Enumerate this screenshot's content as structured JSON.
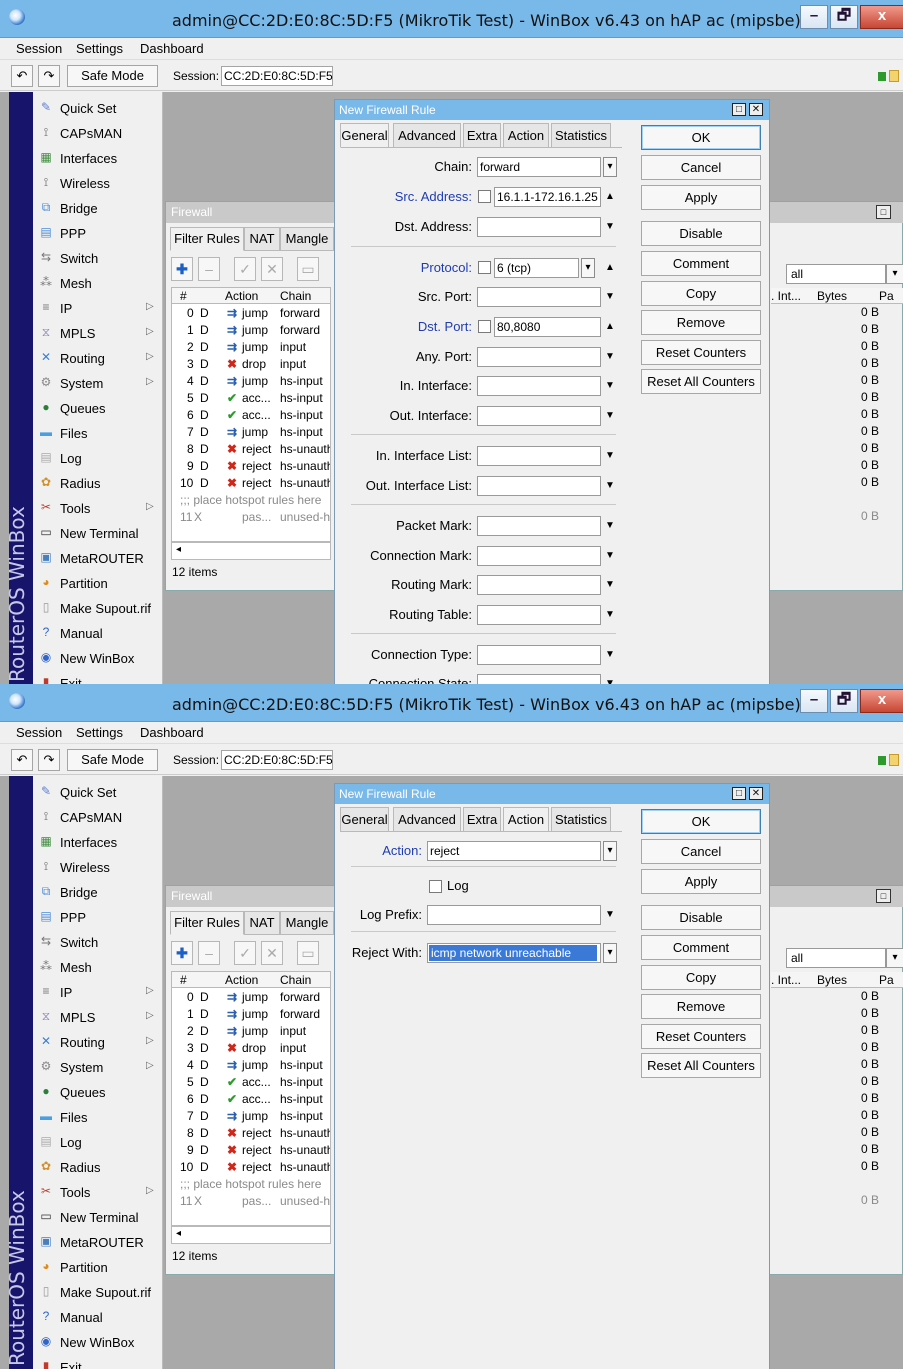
{
  "window": {
    "title": "admin@CC:2D:E0:8C:5D:F5 (MikroTik Test) - WinBox v6.43 on hAP ac (mipsbe)",
    "minimize": "–",
    "maximize": "🗗",
    "close": "x"
  },
  "menu": [
    "Session",
    "Settings",
    "Dashboard"
  ],
  "toolbar": {
    "undo": "↶",
    "redo": "↷",
    "safe_mode": "Safe Mode",
    "session_label": "Session:",
    "session_value": "CC:2D:E0:8C:5D:F5"
  },
  "brand": "RouterOS WinBox",
  "sidebar": [
    {
      "label": "Quick Set",
      "icon": "quick-set-icon",
      "color": "#5b7fd1"
    },
    {
      "label": "CAPsMAN",
      "icon": "capsman-icon",
      "color": "#6a6a6a"
    },
    {
      "label": "Interfaces",
      "icon": "interfaces-icon",
      "color": "#3d8b3d"
    },
    {
      "label": "Wireless",
      "icon": "wireless-icon",
      "color": "#6a6a6a"
    },
    {
      "label": "Bridge",
      "icon": "bridge-icon",
      "color": "#4c8bd6"
    },
    {
      "label": "PPP",
      "icon": "ppp-icon",
      "color": "#4c8bd6"
    },
    {
      "label": "Switch",
      "icon": "switch-icon",
      "color": "#777"
    },
    {
      "label": "Mesh",
      "icon": "mesh-icon",
      "color": "#777"
    },
    {
      "label": "IP",
      "icon": "ip-icon",
      "color": "#777",
      "arrow": "▷"
    },
    {
      "label": "MPLS",
      "icon": "mpls-icon",
      "color": "#8a8ab8",
      "arrow": "▷"
    },
    {
      "label": "Routing",
      "icon": "routing-icon",
      "color": "#3a7fd5",
      "arrow": "▷"
    },
    {
      "label": "System",
      "icon": "system-icon",
      "color": "#888",
      "arrow": "▷"
    },
    {
      "label": "Queues",
      "icon": "queues-icon",
      "color": "#2c7f3a"
    },
    {
      "label": "Files",
      "icon": "files-icon",
      "color": "#4a9fe0"
    },
    {
      "label": "Log",
      "icon": "log-icon",
      "color": "#aaa"
    },
    {
      "label": "Radius",
      "icon": "radius-icon",
      "color": "#d0902e"
    },
    {
      "label": "Tools",
      "icon": "tools-icon",
      "color": "#c0392b",
      "arrow": "▷"
    },
    {
      "label": "New Terminal",
      "icon": "terminal-icon",
      "color": "#333"
    },
    {
      "label": "MetaROUTER",
      "icon": "metarouter-icon",
      "color": "#4a7fbf"
    },
    {
      "label": "Partition",
      "icon": "partition-icon",
      "color": "#e08a1e"
    },
    {
      "label": "Make Supout.rif",
      "icon": "supout-icon",
      "color": "#999"
    },
    {
      "label": "Manual",
      "icon": "manual-icon",
      "color": "#2f64c8"
    },
    {
      "label": "New WinBox",
      "icon": "new-winbox-icon",
      "color": "#2f64c8"
    },
    {
      "label": "Exit",
      "icon": "exit-icon",
      "color": "#c0392b"
    }
  ],
  "firewall": {
    "title": "Firewall",
    "tabs": [
      "Filter Rules",
      "NAT",
      "Mangle"
    ],
    "columns": {
      "num": "#",
      "action": "Action",
      "chain": "Chain",
      "int": ". Int...",
      "bytes": "Bytes",
      "pa": "Pa"
    },
    "filter_value": "all",
    "rows": [
      {
        "num": "0",
        "flag": "D",
        "icon": "⇉",
        "icon_color": "#2a5fb0",
        "action": "jump",
        "chain": "forward",
        "bytes": "0 B"
      },
      {
        "num": "1",
        "flag": "D",
        "icon": "⇉",
        "icon_color": "#2a5fb0",
        "action": "jump",
        "chain": "forward",
        "bytes": "0 B"
      },
      {
        "num": "2",
        "flag": "D",
        "icon": "⇉",
        "icon_color": "#2a5fb0",
        "action": "jump",
        "chain": "input",
        "bytes": "0 B"
      },
      {
        "num": "3",
        "flag": "D",
        "icon": "✖",
        "icon_color": "#d0271b",
        "action": "drop",
        "chain": "input",
        "bytes": "0 B"
      },
      {
        "num": "4",
        "flag": "D",
        "icon": "⇉",
        "icon_color": "#2a5fb0",
        "action": "jump",
        "chain": "hs-input",
        "bytes": "0 B"
      },
      {
        "num": "5",
        "flag": "D",
        "icon": "✔",
        "icon_color": "#2e9b2e",
        "action": "acc...",
        "chain": "hs-input",
        "bytes": "0 B"
      },
      {
        "num": "6",
        "flag": "D",
        "icon": "✔",
        "icon_color": "#2e9b2e",
        "action": "acc...",
        "chain": "hs-input",
        "bytes": "0 B"
      },
      {
        "num": "7",
        "flag": "D",
        "icon": "⇉",
        "icon_color": "#2a5fb0",
        "action": "jump",
        "chain": "hs-input",
        "bytes": "0 B"
      },
      {
        "num": "8",
        "flag": "D",
        "icon": "✖",
        "icon_color": "#d0271b",
        "action": "reject",
        "chain": "hs-unauth",
        "bytes": "0 B"
      },
      {
        "num": "9",
        "flag": "D",
        "icon": "✖",
        "icon_color": "#d0271b",
        "action": "reject",
        "chain": "hs-unauth",
        "bytes": "0 B"
      },
      {
        "num": "10",
        "flag": "D",
        "icon": "✖",
        "icon_color": "#d0271b",
        "action": "reject",
        "chain": "hs-unauth",
        "bytes": "0 B"
      }
    ],
    "comment_row": ";;; place hotspot rules here",
    "disabled_row": {
      "num": "11",
      "flag": "X",
      "action": "pas...",
      "chain": "unused-h",
      "bytes": "0 B"
    },
    "count": "12 items"
  },
  "dialog": {
    "title": "New Firewall Rule",
    "tabs": [
      "General",
      "Advanced",
      "Extra",
      "Action",
      "Statistics"
    ],
    "buttons": [
      "OK",
      "Cancel",
      "Apply",
      "Disable",
      "Comment",
      "Copy",
      "Remove",
      "Reset Counters",
      "Reset All Counters"
    ],
    "general": {
      "chain_label": "Chain:",
      "chain": "forward",
      "src_address_label": "Src. Address:",
      "src_address": "16.1.1-172.16.1.25",
      "dst_address_label": "Dst. Address:",
      "protocol_label": "Protocol:",
      "protocol": "6 (tcp)",
      "src_port_label": "Src. Port:",
      "dst_port_label": "Dst. Port:",
      "dst_port": "80,8080",
      "any_port_label": "Any. Port:",
      "in_interface_label": "In. Interface:",
      "out_interface_label": "Out. Interface:",
      "in_interface_list_label": "In. Interface List:",
      "out_interface_list_label": "Out. Interface List:",
      "packet_mark_label": "Packet Mark:",
      "connection_mark_label": "Connection Mark:",
      "routing_mark_label": "Routing Mark:",
      "routing_table_label": "Routing Table:",
      "connection_type_label": "Connection Type:",
      "connection_state_label": "Connection State:"
    },
    "action": {
      "action_label": "Action:",
      "action": "reject",
      "log_label": "Log",
      "log_prefix_label": "Log Prefix:",
      "reject_with_label": "Reject With:",
      "reject_with": "icmp network unreachable"
    }
  }
}
